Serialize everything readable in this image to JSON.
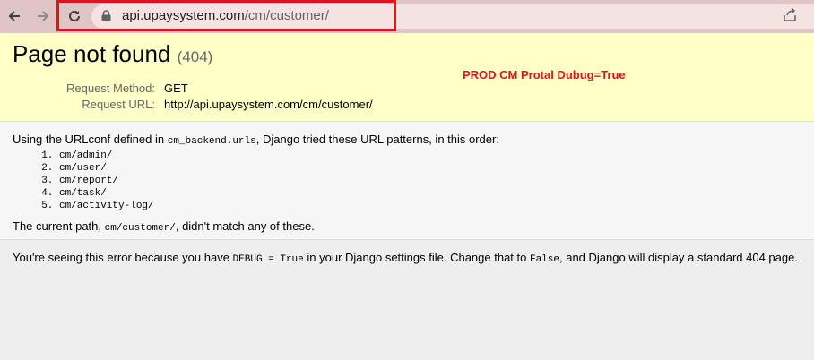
{
  "browser": {
    "url_domain": "api.upaysystem.com",
    "url_path": "/cm/customer/",
    "back_icon": "arrow-left-icon",
    "forward_icon": "arrow-right-icon",
    "reload_icon": "reload-icon",
    "lock_icon": "lock-icon",
    "share_icon": "share-icon"
  },
  "summary": {
    "title": "Page not found",
    "code": "(404)",
    "request_method_label": "Request Method:",
    "request_method_value": "GET",
    "request_url_label": "Request URL:",
    "request_url_value": "http://api.upaysystem.com/cm/customer/"
  },
  "annotation": {
    "text": "PROD CM Protal Dubug=True",
    "color": "#e0141e"
  },
  "info": {
    "intro_before": "Using the URLconf defined in ",
    "intro_module": "cm_backend.urls",
    "intro_after": ", Django tried these URL patterns, in this order:",
    "patterns": [
      "cm/admin/",
      "cm/user/",
      "cm/report/",
      "cm/task/",
      "cm/activity-log/"
    ],
    "current_before": "The current path, ",
    "current_path": "cm/customer/",
    "current_after": ", didn't match any of these."
  },
  "explanation": {
    "before": "You're seeing this error because you have ",
    "debug_code": "DEBUG = True",
    "middle": " in your Django settings file. Change that to ",
    "false_code": "False",
    "after": ", and Django will display a standard 404 page."
  },
  "colors": {
    "summary_bg": "#ffffc8",
    "toolbar_bg": "#dfc6c4"
  }
}
